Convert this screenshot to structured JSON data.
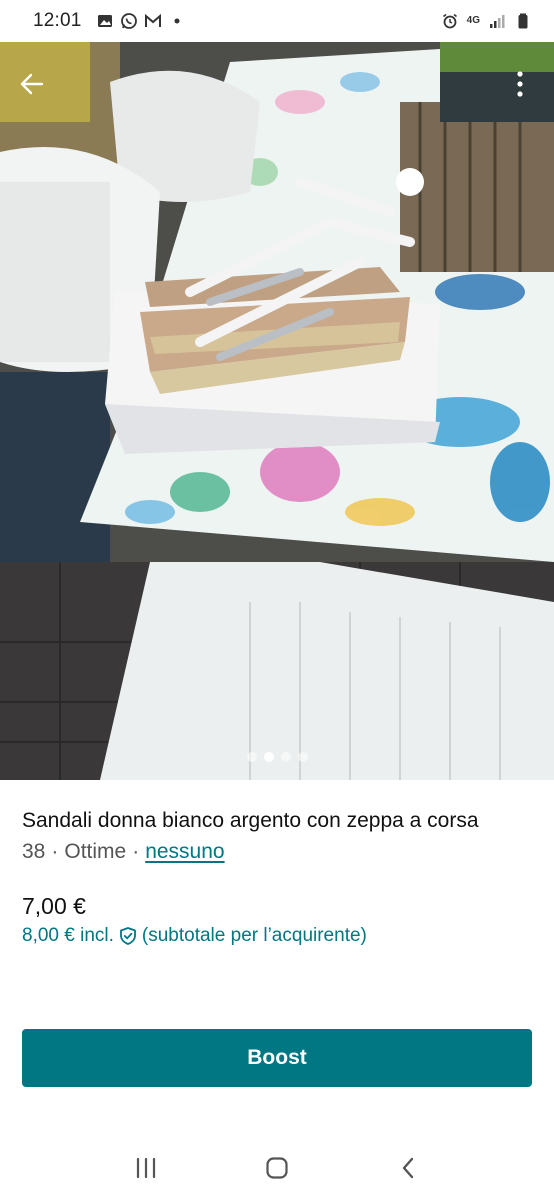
{
  "status_bar": {
    "time": "12:01",
    "network": "4G"
  },
  "photo": {
    "carousel_count": 4,
    "carousel_active_index": 1
  },
  "listing": {
    "title": "Sandali  donna bianco argento  con zeppa a corsa",
    "size": "38",
    "condition": "Ottime",
    "brand": "nessuno",
    "separator": "·",
    "price": "7,00 €",
    "price_incl": "8,00 € incl.",
    "price_incl_note": "(subtotale per l’acquirente)"
  },
  "actions": {
    "boost_label": "Boost"
  },
  "colors": {
    "accent": "#007782"
  }
}
